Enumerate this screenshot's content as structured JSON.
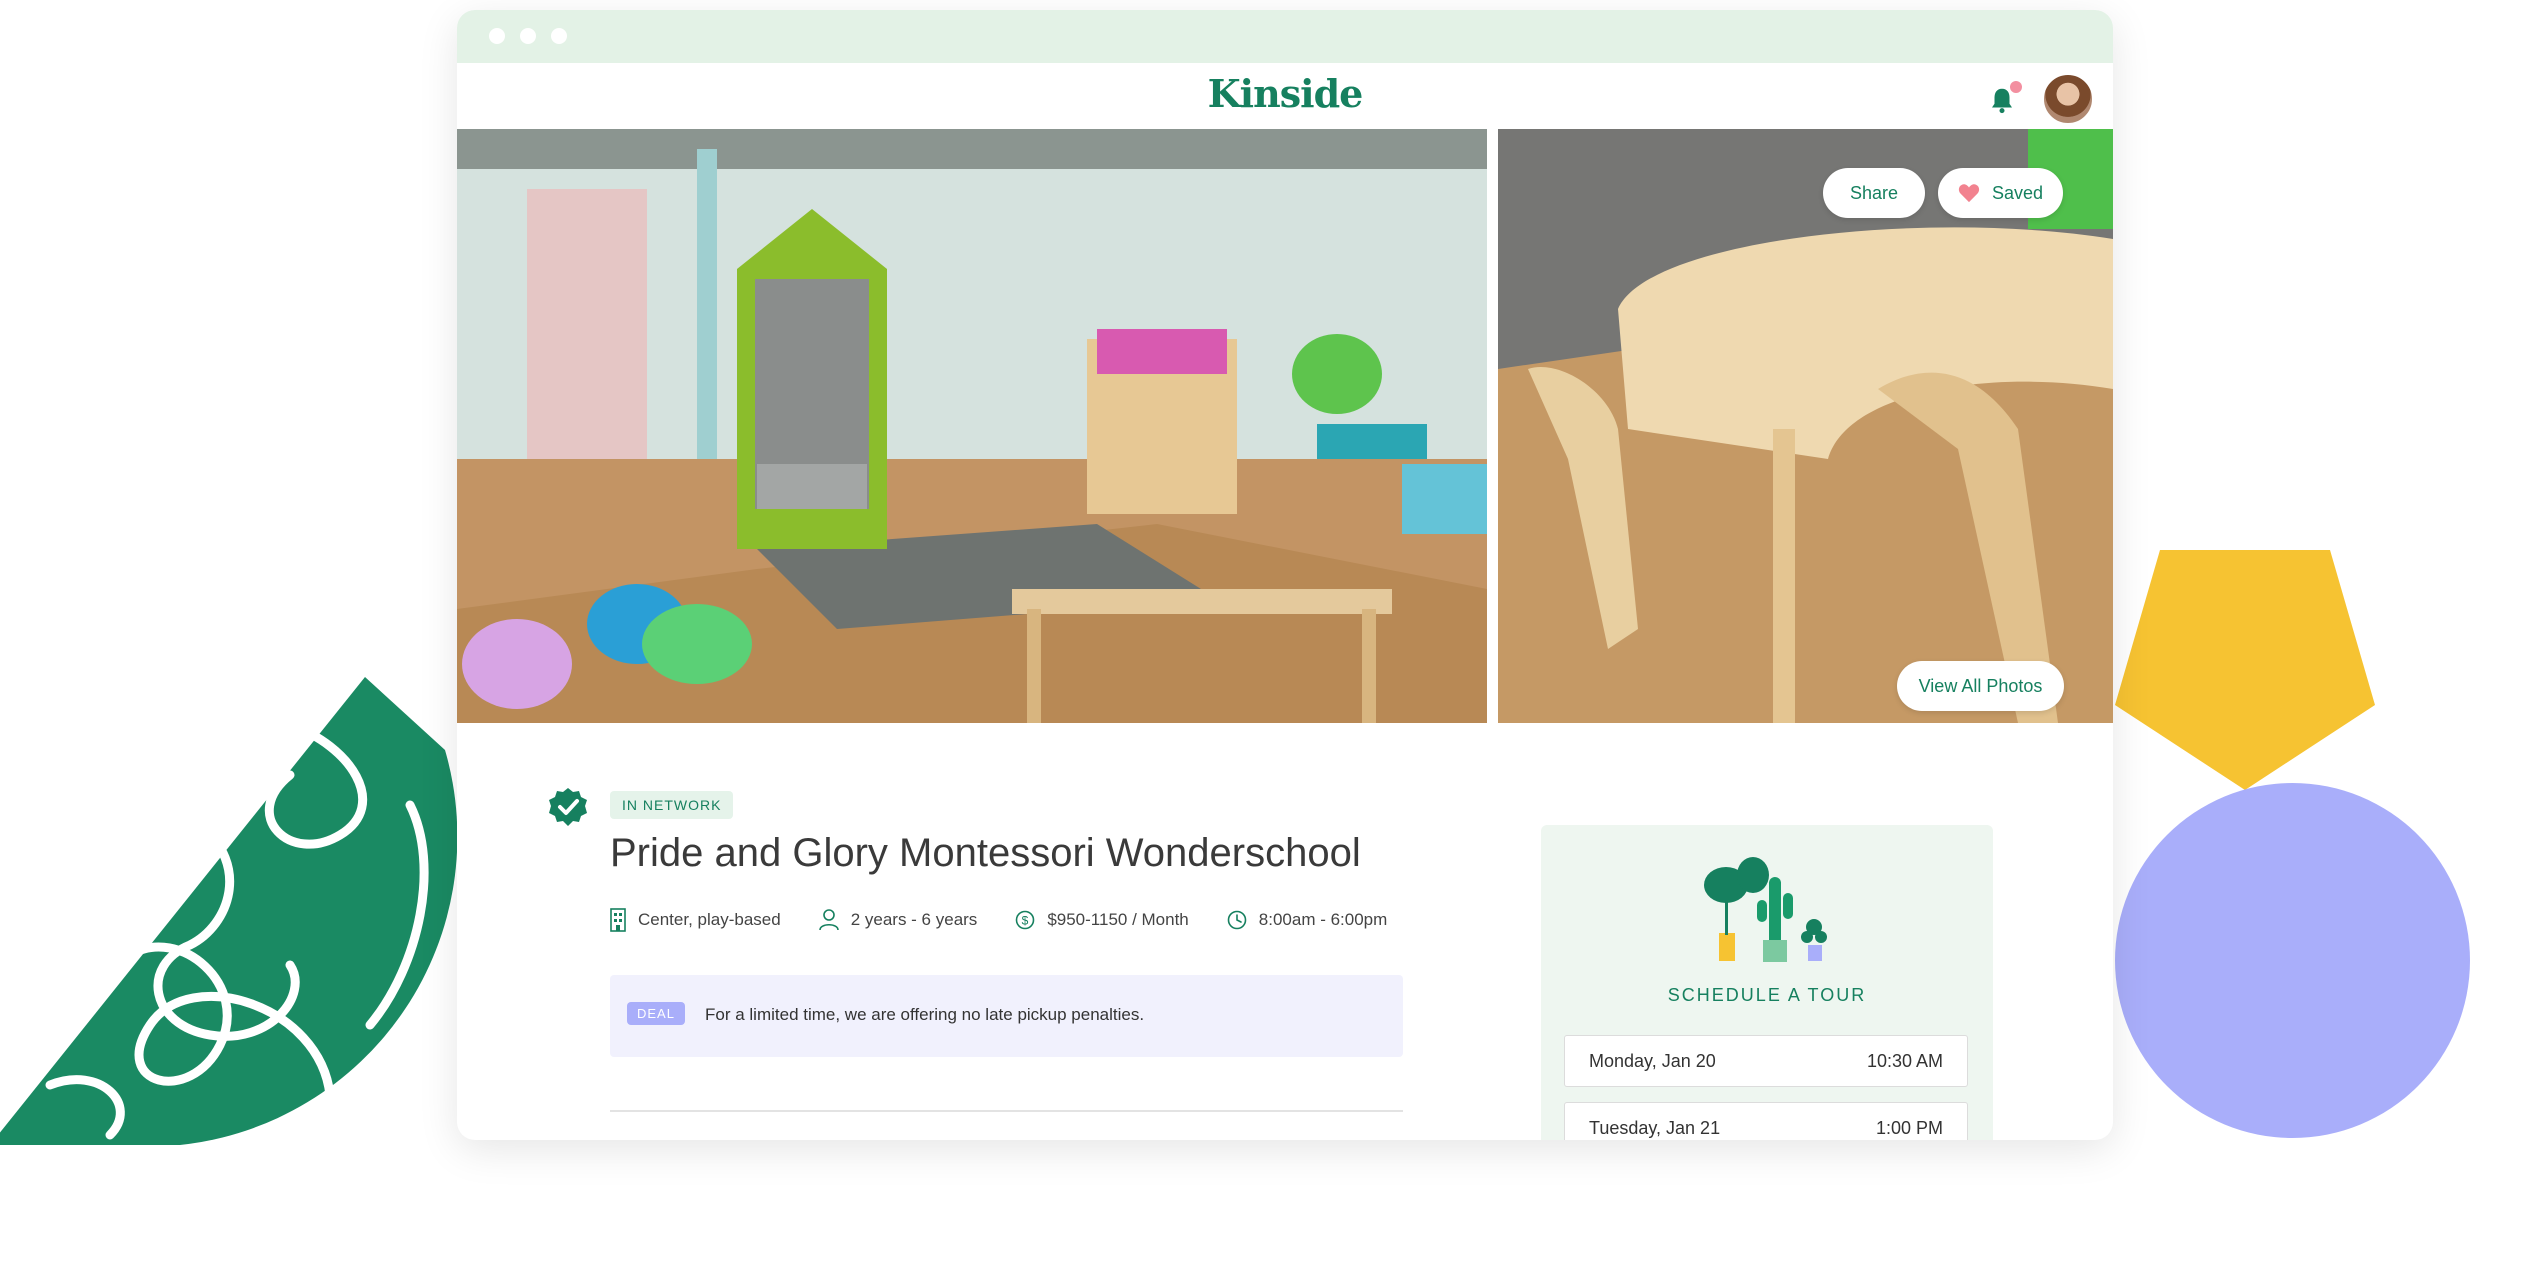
{
  "brand": {
    "logo_text": "Kinside",
    "primary_color": "#16805f",
    "accent_lilac": "#a9aefa",
    "accent_yellow": "#f6c332",
    "chrome_color": "#e3f2e6"
  },
  "header": {
    "notification_icon": "bell-icon",
    "avatar": "user-avatar"
  },
  "gallery": {
    "share_label": "Share",
    "saved_label": "Saved",
    "view_all_label": "View All Photos"
  },
  "listing": {
    "network_tag": "IN NETWORK",
    "name": "Pride and Glory Montessori Wonderschool",
    "type": "Center, play-based",
    "ages": "2 years - 6 years",
    "price": "$950-1150 / Month",
    "hours": "8:00am - 6:00pm",
    "deal_tag": "DEAL",
    "deal_text": "For a limited time, we are offering no late pickup penalties."
  },
  "tour": {
    "title": "SCHEDULE A TOUR",
    "slots": [
      {
        "day": "Monday, Jan 20",
        "time": "10:30 AM"
      },
      {
        "day": "Tuesday, Jan 21",
        "time": "1:00 PM"
      }
    ]
  }
}
